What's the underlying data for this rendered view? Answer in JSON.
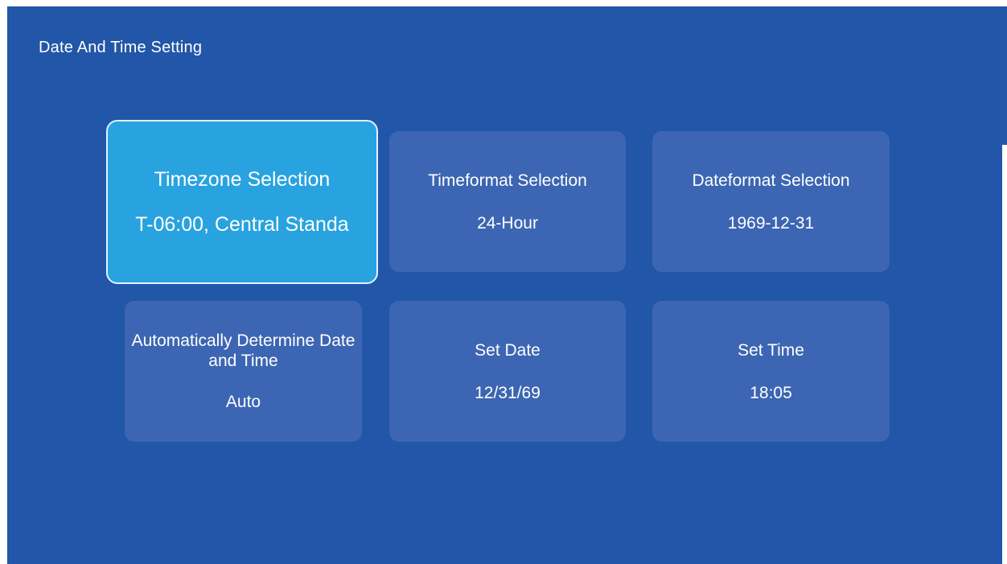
{
  "header": {
    "title": "Date And Time Setting"
  },
  "tiles": [
    {
      "label": "Timezone Selection",
      "value": "T-06:00, Central Standa"
    },
    {
      "label": "Timeformat Selection",
      "value": "24-Hour"
    },
    {
      "label": "Dateformat Selection",
      "value": "1969-12-31"
    },
    {
      "label": "Automatically Determine Date and Time",
      "value": "Auto"
    },
    {
      "label": "Set Date",
      "value": "12/31/69"
    },
    {
      "label": "Set Time",
      "value": "18:05"
    }
  ],
  "colors": {
    "background": "#2256a8",
    "tile": "#3c66b3",
    "tile_focused": "#28a3df",
    "text": "#ffffff"
  }
}
